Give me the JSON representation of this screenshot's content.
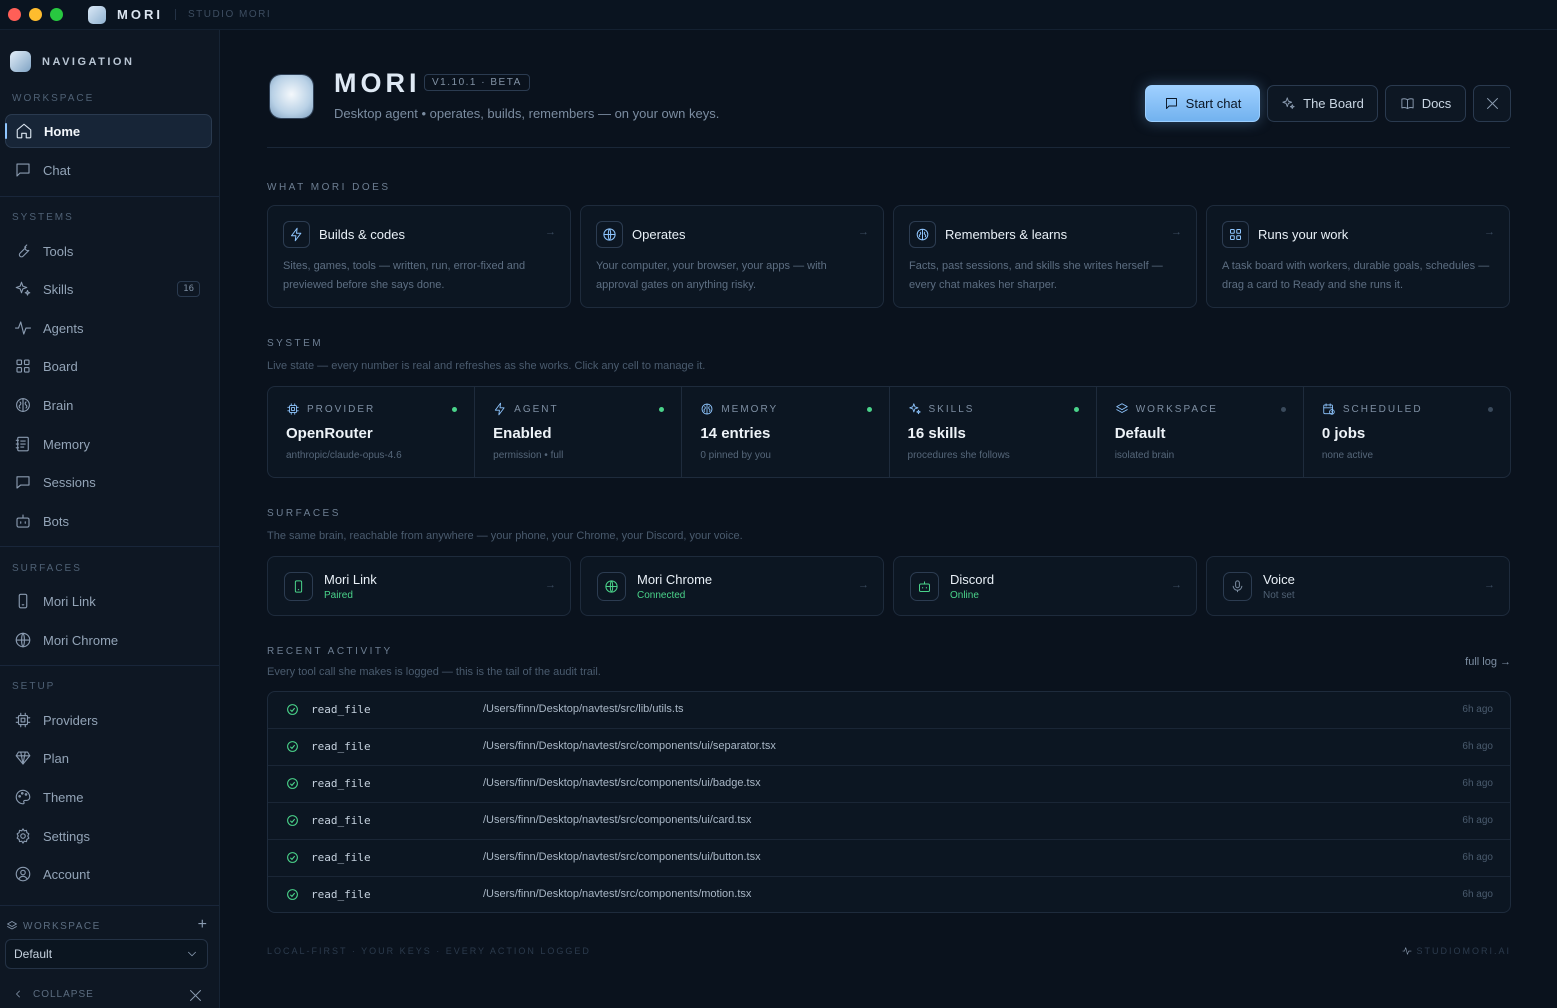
{
  "window": {
    "title": "MORI",
    "subtitle": "STUDIO MORI"
  },
  "sidebar": {
    "header": "NAVIGATION",
    "sections": {
      "workspace": "WORKSPACE",
      "systems": "SYSTEMS",
      "surfaces": "SURFACES",
      "setup": "SETUP"
    },
    "items": [
      {
        "label": "Home",
        "icon": "home-icon",
        "active": true
      },
      {
        "label": "Chat",
        "icon": "chat-icon"
      },
      {
        "label": "Tools",
        "icon": "wrench-icon"
      },
      {
        "label": "Skills",
        "icon": "sparkles-icon",
        "badge": "16"
      },
      {
        "label": "Agents",
        "icon": "activity-icon"
      },
      {
        "label": "Board",
        "icon": "grid-icon"
      },
      {
        "label": "Brain",
        "icon": "brain-icon"
      },
      {
        "label": "Memory",
        "icon": "notebook-icon"
      },
      {
        "label": "Sessions",
        "icon": "message-square-icon"
      },
      {
        "label": "Bots",
        "icon": "bot-icon"
      },
      {
        "label": "Mori Link",
        "icon": "smartphone-icon"
      },
      {
        "label": "Mori Chrome",
        "icon": "globe-icon"
      },
      {
        "label": "Providers",
        "icon": "cpu-icon"
      },
      {
        "label": "Plan",
        "icon": "gem-icon"
      },
      {
        "label": "Theme",
        "icon": "palette-icon"
      },
      {
        "label": "Settings",
        "icon": "gear-icon"
      },
      {
        "label": "Account",
        "icon": "user-circle-icon"
      }
    ],
    "workspace_label": "WORKSPACE",
    "workspace_value": "Default",
    "collapse": "COLLAPSE"
  },
  "hero": {
    "title": "MORI",
    "version": "V1.10.1 · BETA",
    "subtitle": "Desktop agent • operates, builds, remembers — on your own keys."
  },
  "actions": {
    "start_chat": "Start chat",
    "board": "The Board",
    "docs": "Docs"
  },
  "what": {
    "heading": "WHAT MORI DOES",
    "cards": [
      {
        "title": "Builds & codes",
        "desc": "Sites, games, tools — written, run, error-fixed and previewed before she says done.",
        "icon": "zap-icon"
      },
      {
        "title": "Operates",
        "desc": "Your computer, your browser, your apps — with approval gates on anything risky.",
        "icon": "globe-icon"
      },
      {
        "title": "Remembers & learns",
        "desc": "Facts, past sessions, and skills she writes herself — every chat makes her sharper.",
        "icon": "brain-icon"
      },
      {
        "title": "Runs your work",
        "desc": "A task board with workers, durable goals, schedules — drag a card to Ready and she runs it.",
        "icon": "grid-icon"
      }
    ]
  },
  "system": {
    "heading": "SYSTEM",
    "desc": "Live state — every number is real and refreshes as she works. Click any cell to manage it.",
    "cells": [
      {
        "label": "PROVIDER",
        "value": "OpenRouter",
        "sub": "anthropic/claude-opus-4.6",
        "status": "active",
        "icon": "cpu-icon"
      },
      {
        "label": "AGENT",
        "value": "Enabled",
        "sub": "permission • full",
        "status": "active",
        "icon": "zap-icon"
      },
      {
        "label": "MEMORY",
        "value": "14 entries",
        "sub": "0 pinned by you",
        "status": "active",
        "icon": "brain-icon"
      },
      {
        "label": "SKILLS",
        "value": "16 skills",
        "sub": "procedures she follows",
        "status": "active",
        "icon": "sparkles-icon"
      },
      {
        "label": "WORKSPACE",
        "value": "Default",
        "sub": "isolated brain",
        "status": "idle",
        "icon": "layers-icon"
      },
      {
        "label": "SCHEDULED",
        "value": "0 jobs",
        "sub": "none active",
        "status": "idle",
        "icon": "calendar-clock-icon"
      }
    ]
  },
  "surfaces": {
    "heading": "SURFACES",
    "desc": "The same brain, reachable from anywhere — your phone, your Chrome, your Discord, your voice.",
    "items": [
      {
        "title": "Mori Link",
        "status": "Paired",
        "state": "on",
        "icon": "smartphone-icon"
      },
      {
        "title": "Mori Chrome",
        "status": "Connected",
        "state": "on",
        "icon": "globe-icon"
      },
      {
        "title": "Discord",
        "status": "Online",
        "state": "on",
        "icon": "bot-icon"
      },
      {
        "title": "Voice",
        "status": "Not set",
        "state": "off",
        "icon": "mic-icon"
      }
    ]
  },
  "activity": {
    "heading": "RECENT ACTIVITY",
    "desc": "Every tool call she makes is logged — this is the tail of the audit trail.",
    "full_log": "full log →",
    "rows": [
      {
        "tool": "read_file",
        "path": "/Users/finn/Desktop/navtest/src/lib/utils.ts",
        "time": "6h ago"
      },
      {
        "tool": "read_file",
        "path": "/Users/finn/Desktop/navtest/src/components/ui/separator.tsx",
        "time": "6h ago"
      },
      {
        "tool": "read_file",
        "path": "/Users/finn/Desktop/navtest/src/components/ui/badge.tsx",
        "time": "6h ago"
      },
      {
        "tool": "read_file",
        "path": "/Users/finn/Desktop/navtest/src/components/ui/card.tsx",
        "time": "6h ago"
      },
      {
        "tool": "read_file",
        "path": "/Users/finn/Desktop/navtest/src/components/ui/button.tsx",
        "time": "6h ago"
      },
      {
        "tool": "read_file",
        "path": "/Users/finn/Desktop/navtest/src/components/motion.tsx",
        "time": "6h ago"
      }
    ]
  },
  "footer": {
    "left": "LOCAL-FIRST · YOUR KEYS · EVERY ACTION LOGGED",
    "right": "STUDIOMORI.AI"
  },
  "colors": {
    "accent": "#8fc6ff",
    "primary_button": "#9fd0ff",
    "success": "#4ad38a",
    "background": "#0a121d",
    "sidebar": "#0e1723"
  }
}
